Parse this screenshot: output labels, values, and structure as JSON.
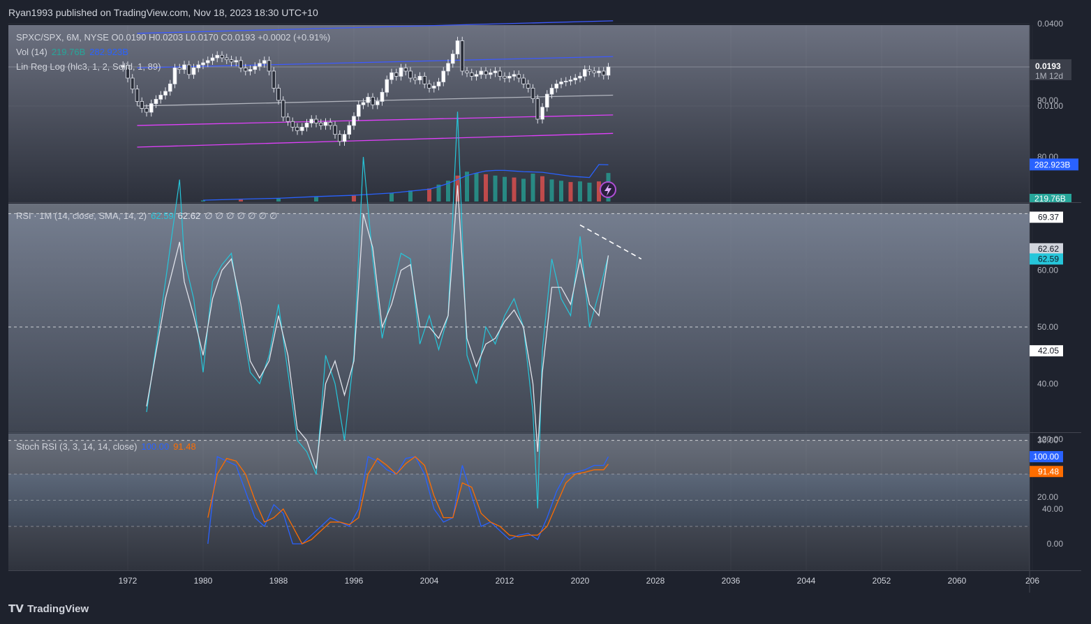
{
  "header": {
    "text": "Ryan1993 published on TradingView.com, Nov 18, 2023 18:30 UTC+10"
  },
  "legend": {
    "price": "SPXC/SPX, 6M, NYSE  O0.0190  H0.0203  L0.0170  C0.0193  +0.0002 (+0.91%)",
    "vol_label": "Vol (14)",
    "vol_v1": "219.76B",
    "vol_v2": "282.923B",
    "linreg": "Lin Reg Log (hlc3, 1, 2, Solid, 1, 89)",
    "rsi_label": "RSI · 1M (14, close, SMA, 14, 2)",
    "rsi_v1": "62.59",
    "rsi_v2": "62.62",
    "rsi_extra": "∅  ∅  ∅  ∅  ∅  ∅  ∅",
    "stoch_label": "Stoch RSI (3, 3, 14, 14, close)",
    "stoch_k": "100.00",
    "stoch_d": "91.48"
  },
  "colors": {
    "bg": "#1e222d",
    "rsi": "#26c6da",
    "rsi_ma": "#e0e3eb",
    "stoch_k": "#2962ff",
    "stoch_d": "#ff6d00",
    "channel_blue": "#3d5afe",
    "channel_magenta": "#e040fb",
    "vol_up": "#26a69a",
    "vol_down": "#ef5350"
  },
  "price_axis": {
    "ticks": [
      "0.0400",
      "0.0100"
    ],
    "last_price": "0.0193",
    "countdown": "1M 12d",
    "vol_ma_tag": "282.923B",
    "vol_tag": "219.76B"
  },
  "rsi_axis": {
    "ticks": [
      "90.00",
      "80.00",
      "60.00",
      "50.00",
      "40.00",
      "30.00",
      "20.00"
    ],
    "tags": [
      "69.37",
      "62.62",
      "62.59",
      "42.05"
    ]
  },
  "stoch_axis": {
    "ticks": [
      "120.00",
      "40.00",
      "0.00"
    ],
    "tags": [
      "100.00",
      "91.48"
    ]
  },
  "time_axis": [
    "1972",
    "1980",
    "1988",
    "1996",
    "2004",
    "2012",
    "2020",
    "2028",
    "2036",
    "2044",
    "2052",
    "2060",
    "206"
  ],
  "footer": {
    "brand": "TradingView"
  },
  "chart_data": [
    {
      "type": "candlestick",
      "title": "SPXC/SPX, 6M, NYSE",
      "x": [
        1971.5,
        1972,
        1972.5,
        1973,
        1973.5,
        1974,
        1974.5,
        1975,
        1975.5,
        1976,
        1976.5,
        1977,
        1977.5,
        1978,
        1978.5,
        1979,
        1979.5,
        1980,
        1980.5,
        1981,
        1981.5,
        1982,
        1982.5,
        1983,
        1983.5,
        1984,
        1984.5,
        1985,
        1985.5,
        1986,
        1986.5,
        1987,
        1987.5,
        1988,
        1988.5,
        1989,
        1989.5,
        1990,
        1990.5,
        1991,
        1991.5,
        1992,
        1992.5,
        1993,
        1993.5,
        1994,
        1994.5,
        1995,
        1995.5,
        1996,
        1996.5,
        1997,
        1997.5,
        1998,
        1998.5,
        1999,
        1999.5,
        2000,
        2000.5,
        2001,
        2001.5,
        2002,
        2002.5,
        2003,
        2003.5,
        2004,
        2004.5,
        2005,
        2005.5,
        2006,
        2006.5,
        2007,
        2007.5,
        2008,
        2008.5,
        2009,
        2009.5,
        2010,
        2010.5,
        2011,
        2011.5,
        2012,
        2012.5,
        2013,
        2013.5,
        2014,
        2014.5,
        2015,
        2015.5,
        2016,
        2016.5,
        2017,
        2017.5,
        2018,
        2018.5,
        2019,
        2019.5,
        2020,
        2020.5,
        2021,
        2021.5,
        2022,
        2022.5,
        2023
      ],
      "close": [
        0.0198,
        0.016,
        0.0133,
        0.0108,
        0.0096,
        0.009,
        0.0104,
        0.0112,
        0.012,
        0.0128,
        0.0145,
        0.019,
        0.0185,
        0.02,
        0.017,
        0.019,
        0.02,
        0.0207,
        0.0215,
        0.0225,
        0.0235,
        0.0225,
        0.0218,
        0.021,
        0.0215,
        0.019,
        0.018,
        0.0185,
        0.0195,
        0.0205,
        0.0215,
        0.018,
        0.0135,
        0.011,
        0.0083,
        0.0077,
        0.007,
        0.0066,
        0.007,
        0.0075,
        0.008,
        0.0075,
        0.0072,
        0.0076,
        0.0072,
        0.0062,
        0.0055,
        0.0062,
        0.0072,
        0.0084,
        0.0102,
        0.0106,
        0.0116,
        0.0102,
        0.0108,
        0.0126,
        0.0156,
        0.0175,
        0.0165,
        0.019,
        0.018,
        0.016,
        0.0155,
        0.0165,
        0.0145,
        0.0135,
        0.014,
        0.015,
        0.018,
        0.0205,
        0.024,
        0.03,
        0.018,
        0.0175,
        0.0165,
        0.017,
        0.018,
        0.017,
        0.0175,
        0.018,
        0.0165,
        0.016,
        0.0165,
        0.017,
        0.016,
        0.0145,
        0.0135,
        0.0113,
        0.008,
        0.0098,
        0.0122,
        0.0135,
        0.0145,
        0.015,
        0.0152,
        0.0155,
        0.016,
        0.0165,
        0.0185,
        0.018,
        0.0175,
        0.018,
        0.0168,
        0.0193
      ]
    },
    {
      "type": "bar",
      "title": "Vol (14)",
      "x": [
        1980,
        1984,
        1988,
        1992,
        1996,
        2000,
        2002,
        2004,
        2005,
        2006,
        2007,
        2008,
        2009,
        2010,
        2011,
        2012,
        2013,
        2014,
        2015,
        2016,
        2017,
        2018,
        2019,
        2020,
        2021,
        2022,
        2023
      ],
      "values": [
        8,
        15,
        22,
        35,
        45,
        65,
        85,
        100,
        130,
        160,
        200,
        230,
        220,
        210,
        200,
        190,
        185,
        175,
        215,
        195,
        170,
        160,
        150,
        155,
        145,
        155,
        219.76
      ],
      "series": [
        {
          "name": "Vol MA",
          "values": [
            10,
            18,
            25,
            38,
            48,
            65,
            80,
            95,
            115,
            140,
            170,
            200,
            220,
            235,
            240,
            240,
            235,
            230,
            228,
            225,
            215,
            205,
            195,
            190,
            185,
            285,
            282.923
          ]
        }
      ],
      "ylabel": ""
    },
    {
      "type": "line",
      "title": "RSI · 1M (14, close, SMA, 14, 2)",
      "x": [
        1974,
        1976,
        1977.5,
        1978,
        1979,
        1980,
        1981,
        1982,
        1983,
        1984,
        1985,
        1986,
        1987,
        1988,
        1989,
        1990,
        1991,
        1992,
        1993,
        1994,
        1995,
        1996,
        1997,
        1998,
        1999,
        2000,
        2001,
        2002,
        2003,
        2004,
        2005,
        2006,
        2007,
        2008,
        2009,
        2010,
        2011,
        2012,
        2013,
        2014,
        2015,
        2015.5,
        2016,
        2017,
        2018,
        2019,
        2020,
        2021,
        2022,
        2023
      ],
      "values": [
        35,
        58,
        76,
        62,
        55,
        42,
        58,
        61,
        63,
        52,
        42,
        40,
        45,
        54,
        42,
        30,
        28,
        24,
        45,
        40,
        30,
        45,
        80,
        62,
        48,
        56,
        63,
        62,
        47,
        52,
        46,
        52,
        88,
        45,
        40,
        50,
        47,
        52,
        55,
        50,
        35,
        18,
        46,
        62,
        55,
        52,
        66,
        50,
        56,
        62.59
      ],
      "series": [
        {
          "name": "SMA",
          "values": [
            36,
            55,
            65,
            58,
            52,
            45,
            55,
            60,
            62,
            54,
            44,
            41,
            44,
            52,
            45,
            32,
            30,
            25,
            40,
            44,
            38,
            44,
            70,
            64,
            50,
            54,
            60,
            61,
            50,
            50,
            48,
            52,
            75,
            48,
            43,
            47,
            48,
            51,
            53,
            50,
            40,
            28,
            42,
            57,
            57,
            54,
            62,
            54,
            52,
            62.62
          ]
        }
      ],
      "ylim": [
        15,
        92
      ]
    },
    {
      "type": "line",
      "title": "Stoch RSI (3, 3, 14, 14, close)",
      "x": [
        1980.5,
        1981.5,
        1982.5,
        1983.5,
        1984.5,
        1985.5,
        1986.5,
        1987.5,
        1988.5,
        1989.5,
        1990.5,
        1991.5,
        1992.5,
        1993.5,
        1994.5,
        1995.5,
        1996.5,
        1997.5,
        1998.5,
        1999.5,
        2000.5,
        2001.5,
        2002.5,
        2003.5,
        2004.5,
        2005.5,
        2006.5,
        2007.5,
        2008.5,
        2009.5,
        2010.5,
        2011.5,
        2012.5,
        2013.5,
        2014.5,
        2015.5,
        2016.5,
        2017.5,
        2018.5,
        2019.5,
        2020.5,
        2021.5,
        2022.5,
        2023
      ],
      "values": [
        0,
        100,
        95,
        90,
        60,
        30,
        20,
        45,
        35,
        0,
        0,
        10,
        20,
        30,
        25,
        20,
        40,
        100,
        95,
        85,
        80,
        98,
        100,
        80,
        40,
        25,
        30,
        90,
        55,
        20,
        25,
        15,
        5,
        10,
        12,
        5,
        30,
        60,
        80,
        82,
        85,
        90,
        90,
        100
      ],
      "series": [
        {
          "name": "D",
          "values": [
            30,
            80,
            98,
            95,
            80,
            50,
            25,
            30,
            40,
            20,
            0,
            5,
            15,
            25,
            25,
            22,
            30,
            80,
            98,
            90,
            80,
            92,
            100,
            90,
            55,
            30,
            30,
            70,
            65,
            35,
            25,
            20,
            10,
            8,
            10,
            10,
            20,
            45,
            70,
            80,
            82,
            85,
            85,
            91.48
          ]
        }
      ],
      "ylim": [
        -20,
        125
      ]
    }
  ]
}
